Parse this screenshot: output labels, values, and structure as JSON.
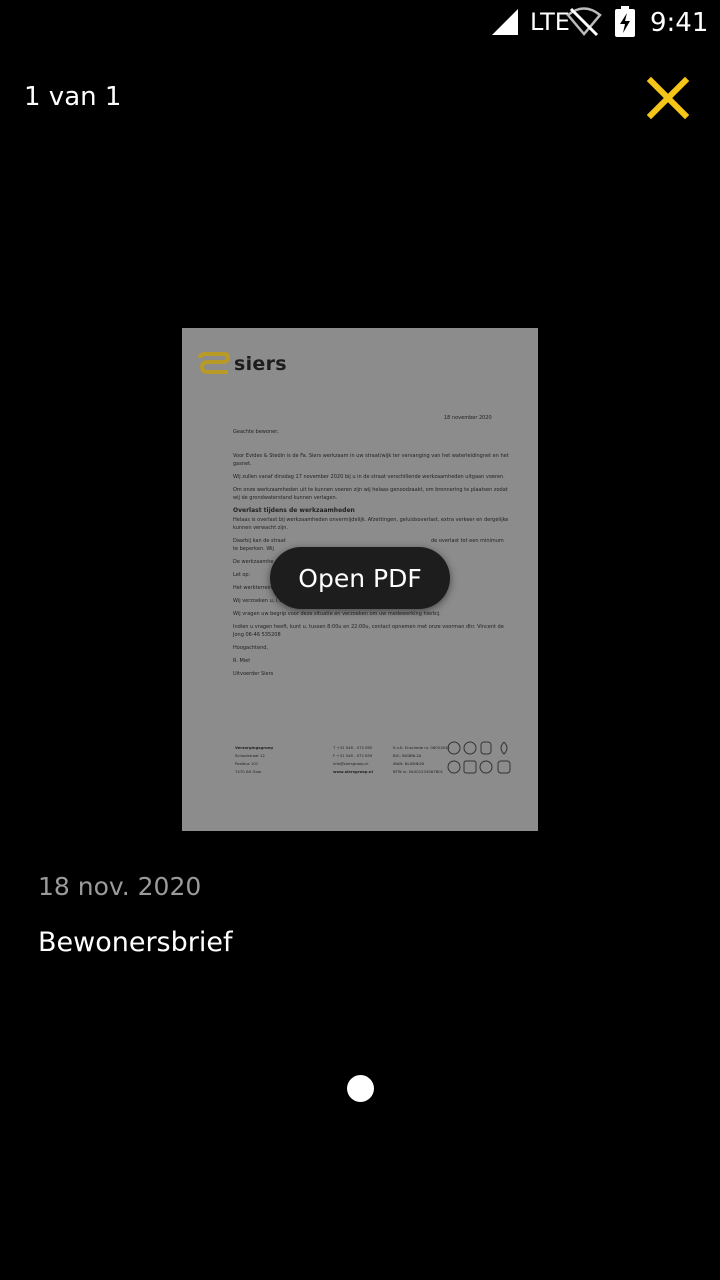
{
  "status_bar": {
    "network": "LTE",
    "time": "9:41",
    "icons": [
      "signal-icon",
      "wifi-off-icon",
      "battery-charging-icon"
    ]
  },
  "header": {
    "page_counter": "1 van 1",
    "close_icon": "close-icon",
    "accent_color": "#F5C518"
  },
  "document": {
    "logo_text": "siers",
    "letter_date": "18 november 2020",
    "greeting": "Geachte bewoner,",
    "paragraphs": [
      "Voor Evides & Stedin is de Fa. Siers werkzaam in uw straat/wijk ter vervanging van het waterleidingnet en het gasnet.",
      "Wij zullen vanaf dinsdag 17 november 2020 bij u in de straat verschillende werkzaamheden uitgaan voeren.",
      "Om onze werkzaamheden uit te kunnen voeren zijn wij helaas genoodzaakt, om bronnering te plaatsen zodat wij de grondwaterstand kunnen verlagen."
    ],
    "section_heading": "Overlast tijdens de werkzaamheden",
    "section_text": "Helaas is overlast bij werkzaamheden onvermijdelijk. Afzettingen, geluidsoverlast, extra verkeer en dergelijke kunnen verwacht zijn.",
    "line_a": "Daarbij kan de straat",
    "line_a_tail": "de overlast tot een minimum",
    "line_b": "te beperken. Wij",
    "line_c": "De werkzaamhe",
    "line_d": "Let op:",
    "line_e": "Het werkterrein wor",
    "line_f": "Wij verzoeken u, i.v.m. uw veiligheid, dit afgezette gebied niet te betreden.",
    "line_g": "Wij vragen uw begrip voor deze situatie en verzoeken om uw medewerking hierbij.",
    "line_h": "Indien u vragen heeft, kunt u, tussen 8:00u en 22:00u, contact opnemen met onze voorman dhr. Vincent de Jong 06-46 535208",
    "closing": "Hoogachtend,",
    "signer": "R. Miet",
    "signer_role": "Uitvoerder Siers",
    "footer_col1": [
      "Verzorgingsgroep",
      "Schoolstraat 12",
      "Postbus 101",
      "7470 AH Goor"
    ],
    "footer_col2": [
      "T +31 546 - 572 850",
      "F +31 546 - 572 859",
      "info@siersgroep.nl",
      "www.siersgroep.nl"
    ],
    "footer_col3": [
      "K.v.K. Enschede nr. 06031634",
      "BIC: INGBNL2A",
      "IBAN: NL00INGB",
      "BTW nr. NL001234567B01"
    ]
  },
  "actions": {
    "open_pdf_label": "Open PDF"
  },
  "meta": {
    "date": "18 nov. 2020",
    "title": "Bewonersbrief"
  },
  "pager": {
    "current": 1,
    "total": 1
  }
}
